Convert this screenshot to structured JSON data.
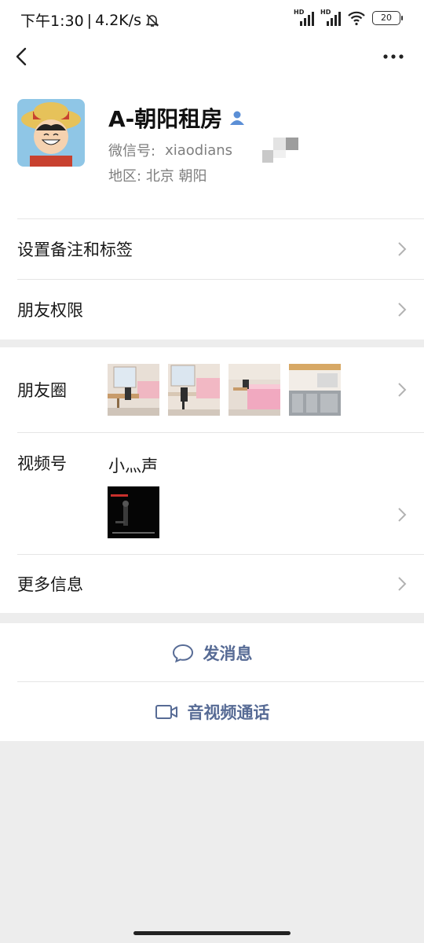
{
  "status": {
    "time": "下午1:30",
    "separator": "|",
    "speed": "4.2K/s",
    "battery": "20",
    "hd1": "HD",
    "hd2": "HD"
  },
  "profile": {
    "name": "A-朝阳租房",
    "wechat_id_label": "微信号:",
    "wechat_id_value": "xiaodians",
    "region_label": "地区:",
    "region_value": "北京  朝阳"
  },
  "menu": {
    "remark_tags": "设置备注和标签",
    "friend_permissions": "朋友权限",
    "moments": "朋友圈",
    "channels": "视频号",
    "channels_name": "小灬声",
    "more_info": "更多信息"
  },
  "actions": {
    "send_message": "发消息",
    "video_call": "音视频通话"
  },
  "colors": {
    "link": "#576b95",
    "background": "#ededed",
    "badge": "#5b8fd6"
  }
}
